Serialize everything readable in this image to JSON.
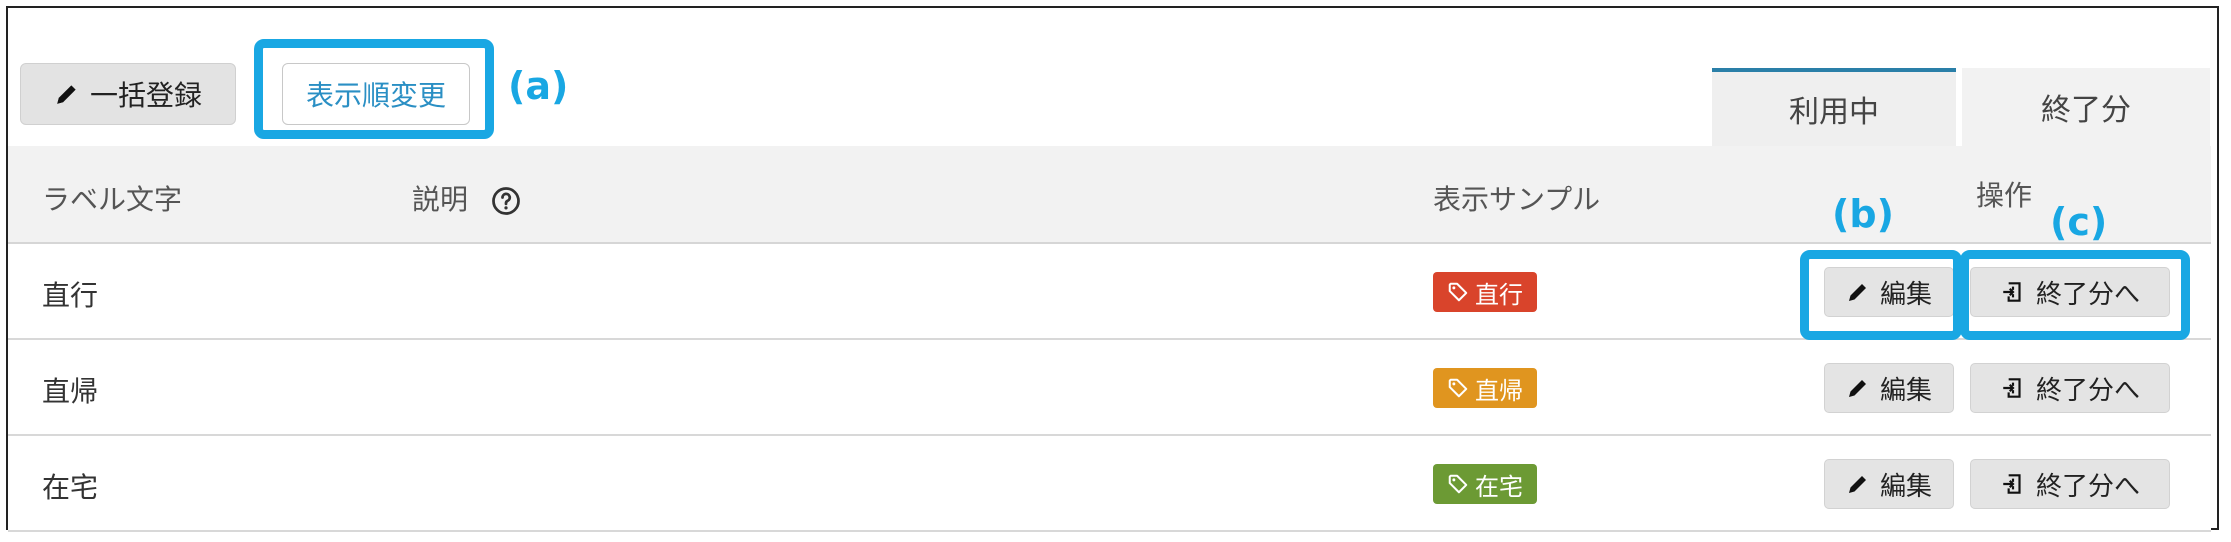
{
  "toolbar": {
    "bulk_label": "一括登録",
    "order_label": "表示順変更"
  },
  "callouts": {
    "a": "(a)",
    "b": "(b)",
    "c": "(c)"
  },
  "tabs": [
    {
      "label": "利用中",
      "active": true
    },
    {
      "label": "終了分",
      "active": false
    }
  ],
  "table": {
    "headers": {
      "label": "ラベル文字",
      "description": "説明",
      "sample": "表示サンプル",
      "actions": "操作"
    },
    "rows": [
      {
        "label": "直行",
        "badge": "直行",
        "badge_color": "#d9442b",
        "edit": "編集",
        "end": "終了分へ"
      },
      {
        "label": "直帰",
        "badge": "直帰",
        "badge_color": "#e0951f",
        "edit": "編集",
        "end": "終了分へ"
      },
      {
        "label": "在宅",
        "badge": "在宅",
        "badge_color": "#6c9a34",
        "edit": "編集",
        "end": "終了分へ"
      }
    ]
  },
  "icons": {
    "bulk": "pencil-icon",
    "help": "question-circle-icon",
    "tag": "tag-icon",
    "edit": "pencil-icon",
    "end": "file-export-icon"
  },
  "colors": {
    "highlight": "#19a7e3",
    "link": "#2a8fc4"
  }
}
